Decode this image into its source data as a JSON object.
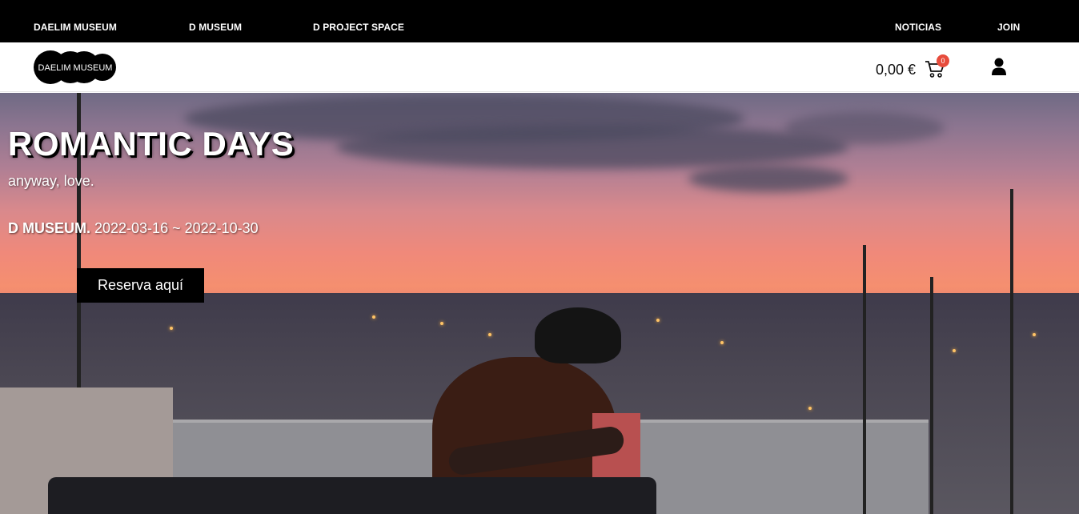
{
  "topnav": {
    "items": [
      {
        "label": "DAELIM MUSEUM"
      },
      {
        "label": "D MUSEUM"
      },
      {
        "label": "D PROJECT SPACE"
      }
    ],
    "right_items": [
      {
        "label": "NOTICIAS"
      },
      {
        "label": "JOIN"
      }
    ]
  },
  "header": {
    "logo_text": "DAELIM MUSEUM",
    "cart_total": "0,00 €",
    "cart_count": "0",
    "icons": {
      "cart": "shopping-cart-icon",
      "user": "user-icon"
    },
    "colors": {
      "badge": "#e74c3c",
      "topbar": "#000000"
    }
  },
  "hero": {
    "title": "ROMANTIC DAYS",
    "subtitle": "anyway, love.",
    "venue": "D MUSEUM.",
    "dates": " 2022-03-16 ~ 2022-10-30",
    "cta_label": "Reserva aquí"
  }
}
